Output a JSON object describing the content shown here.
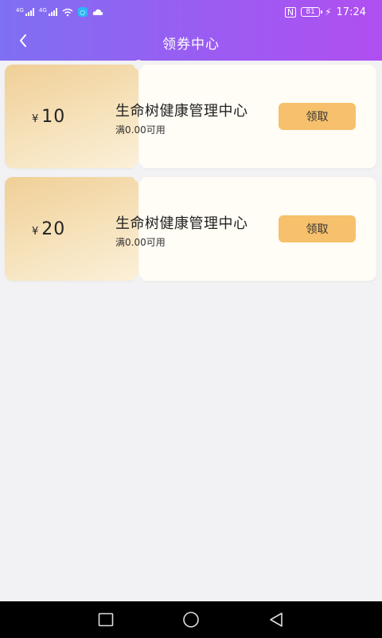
{
  "status_bar": {
    "signal1_tag": "4G",
    "signal2_tag": "4G",
    "battery": "81",
    "time": "17:24"
  },
  "header": {
    "title": "领券中心"
  },
  "coupons": [
    {
      "currency": "¥",
      "value": "10",
      "name": "生命树健康管理中心",
      "condition": "满0.00可用",
      "button": "领取"
    },
    {
      "currency": "¥",
      "value": "20",
      "name": "生命树健康管理中心",
      "condition": "满0.00可用",
      "button": "领取"
    }
  ],
  "colors": {
    "header_start": "#7f6ff2",
    "header_end": "#b04ff1",
    "button": "#f6c06c",
    "coupon_left": "#f0cf96",
    "background": "#f2f2f4"
  },
  "icons": {
    "back": "chevron-left-icon",
    "recent_apps": "square-icon",
    "home": "circle-icon",
    "back_nav": "triangle-back-icon"
  }
}
